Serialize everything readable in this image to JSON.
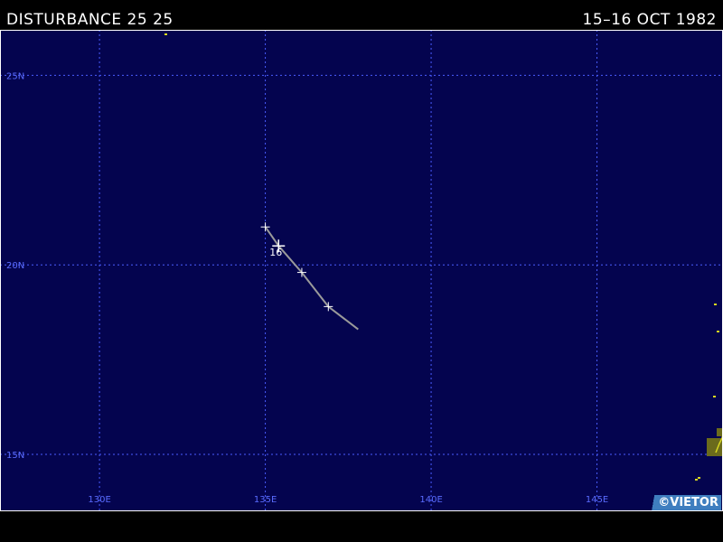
{
  "header": {
    "storm_title": "DISTURBANCE 25 25",
    "date_range": "15–16 OCT 1982"
  },
  "map": {
    "ocean_color": "#04044f",
    "grid_color": "#4a5cff",
    "label_color": "#5a6cff",
    "track_color": "#9a9a9a",
    "marker_color": "#ffffff",
    "land_color": "#d8d820",
    "lon_range": [
      127.0,
      148.8
    ],
    "lat_range": [
      13.5,
      26.2
    ],
    "lon_lines": [
      {
        "value": 130,
        "label": "130E"
      },
      {
        "value": 135,
        "label": "135E"
      },
      {
        "value": 140,
        "label": "140E"
      },
      {
        "value": 145,
        "label": "145E"
      }
    ],
    "lat_lines": [
      {
        "value": 25,
        "label": "25N"
      },
      {
        "value": 20,
        "label": "20N"
      },
      {
        "value": 15,
        "label": "15N"
      }
    ]
  },
  "track": {
    "points": [
      {
        "lon": 135.0,
        "lat": 21.0
      },
      {
        "lon": 135.4,
        "lat": 20.5,
        "day_label": "16"
      },
      {
        "lon": 136.1,
        "lat": 19.8
      },
      {
        "lon": 136.9,
        "lat": 18.9
      },
      {
        "lon": 137.8,
        "lat": 18.3
      }
    ],
    "markers": [
      0,
      1,
      2,
      3
    ],
    "major_marker": 1
  },
  "credit": {
    "text": "©VIETOR"
  }
}
